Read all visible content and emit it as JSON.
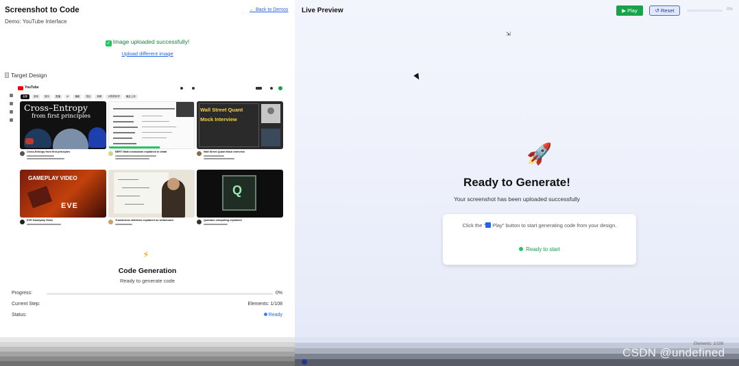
{
  "left": {
    "title": "Screenshot to Code",
    "subtitle": "Demo: YouTube Interface",
    "back_link": "← Back to Demos",
    "upload_status": "Image uploaded successfully!",
    "upload_again": "Upload different image",
    "target_title": "Target Design",
    "target": {
      "logo_text": "YouTube",
      "chips": [
        "全部",
        "游戏",
        "音乐",
        "直播",
        "AI",
        "播客",
        "混合",
        "新闻",
        "计算机科学",
        "最近上传"
      ],
      "videos": [
        {
          "title": "Cross-Entropy from first principles",
          "thumb_big": "Cross–Entropy",
          "thumb_mid": "from first principles"
        },
        {
          "title": "BERT Math breakdown explained in detail"
        },
        {
          "title": "Wall Street Quant Mock Interview",
          "thumb_line1": "Wall Street Quant",
          "thumb_line2": "Mock Interview"
        },
        {
          "title": "EVE Gameplay Video",
          "thumb_text": "GAMEPLAY VIDEO",
          "thumb_logo": "EVE"
        },
        {
          "title": "Transformer attention explained on whiteboard"
        },
        {
          "title": "Quantum computing explained",
          "thumb_logo": "Q"
        }
      ]
    },
    "codegen": {
      "icon": "⚡",
      "title": "Code Generation",
      "subtitle": "Ready to generate code",
      "progress_label": "Progress:",
      "progress_value": "0%",
      "progress_fraction": 0,
      "step_label": "Current Step:",
      "step_value": "Elements: 1/108",
      "status_label": "Status:",
      "status_value": "Ready"
    }
  },
  "right": {
    "title": "Live Preview",
    "play_label": "▶ Play",
    "reset_label": "↺ Reset",
    "top_percent": "0%",
    "rocket": "🚀",
    "heading": "Ready to Generate!",
    "sub": "Your screenshot has been uploaded successfully",
    "card_text_before": "Click the \"",
    "card_text_play": "Play",
    "card_text_after": "\" button to start generating code from your design.",
    "card_status": "Ready to start",
    "ghost_label": "Elements: 1/108",
    "watermark": "CSDN @undefined"
  },
  "colors": {
    "accent": "#2563eb",
    "success": "#16a34a",
    "preview_bg": "#eef1fb"
  }
}
